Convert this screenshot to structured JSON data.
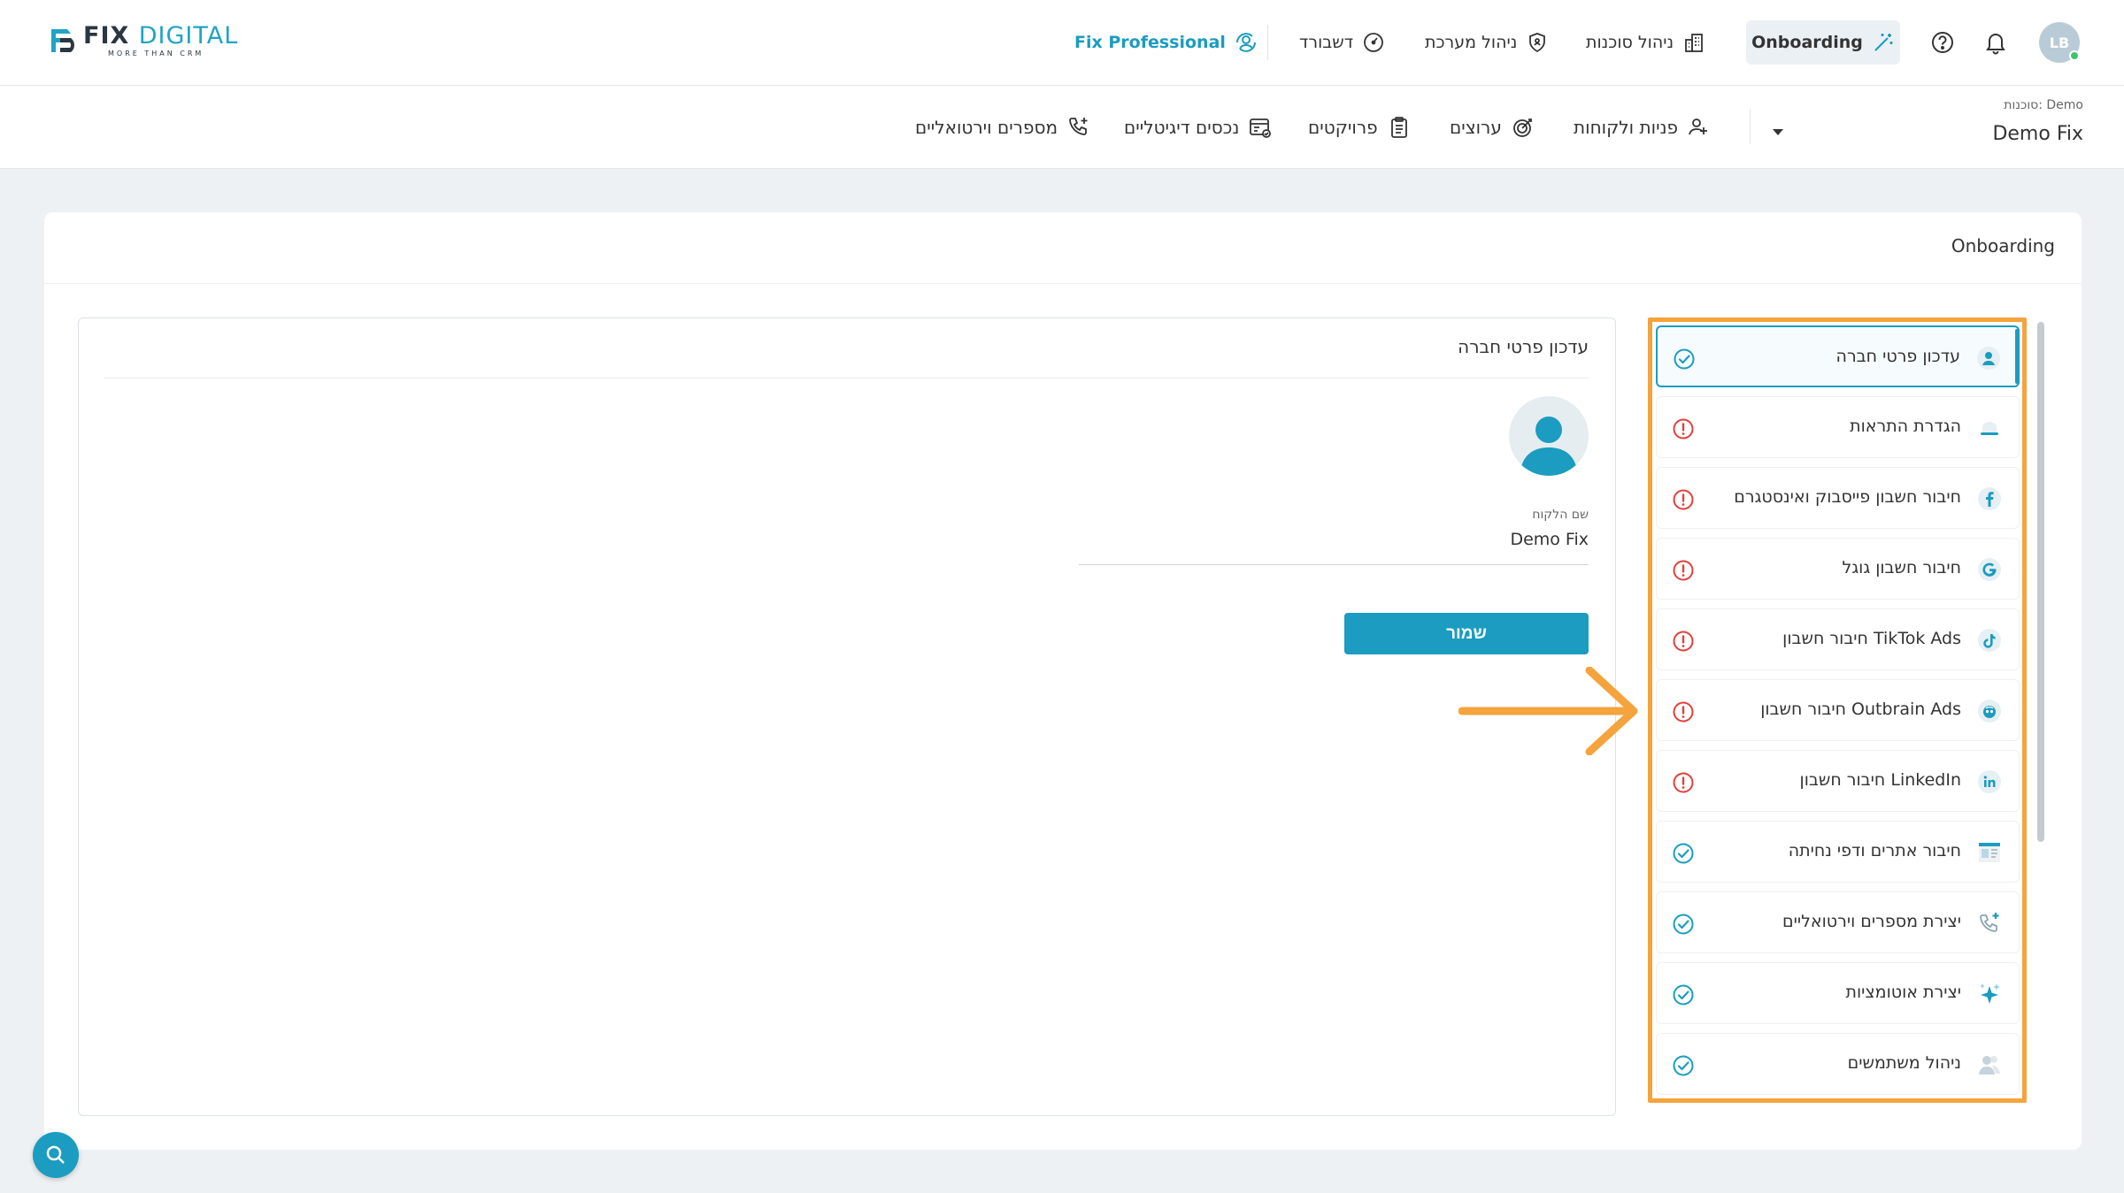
{
  "brand": {
    "logo_main_a": "FIX ",
    "logo_main_b": "DIGITAL",
    "logo_sub": "MORE THAN CRM",
    "accent": "#1b9cc0",
    "highlight": "#f5a33c"
  },
  "header": {
    "fix_professional": "Fix Professional",
    "dashboard": "דשבורד",
    "system_management": "ניהול מערכת",
    "agency_management": "ניהול סוכנות",
    "onboarding": "Onboarding",
    "avatar_initials": "LB"
  },
  "subnav": {
    "agency_label": "סוכנות: Demo",
    "agency_name": "Demo Fix",
    "items": [
      {
        "label": "פניות ולקוחות",
        "icon": "users-icon"
      },
      {
        "label": "ערוצים",
        "icon": "target-icon"
      },
      {
        "label": "פרויקטים",
        "icon": "clipboard-icon"
      },
      {
        "label": "נכסים דיגיטליים",
        "icon": "digital-assets-icon"
      },
      {
        "label": "מספרים וירטואליים",
        "icon": "phone-plus-icon"
      }
    ]
  },
  "page": {
    "title": "Onboarding"
  },
  "form": {
    "title": "עדכון פרטי חברה",
    "customer_name_label": "שם הלקוח",
    "customer_name_value": "Demo Fix",
    "save_label": "שמור"
  },
  "steps": [
    {
      "label": "עדכון פרטי חברה",
      "icon": "person-icon",
      "status": "done",
      "active": true
    },
    {
      "label": "הגדרת התראות",
      "icon": "bell-icon",
      "status": "warning",
      "active": false
    },
    {
      "label": "חיבור חשבון פייסבוק ואינסטגרם",
      "icon": "facebook-icon",
      "status": "warning",
      "active": false
    },
    {
      "label": "חיבור חשבון גוגל",
      "icon": "google-icon",
      "status": "warning",
      "active": false
    },
    {
      "label": "חיבור חשבון TikTok Ads",
      "icon": "tiktok-icon",
      "status": "warning",
      "active": false
    },
    {
      "label": "חיבור חשבון Outbrain Ads",
      "icon": "outbrain-icon",
      "status": "warning",
      "active": false
    },
    {
      "label": "חיבור חשבון LinkedIn",
      "icon": "linkedin-icon",
      "status": "warning",
      "active": false
    },
    {
      "label": "חיבור אתרים ודפי נחיתה",
      "icon": "landing-page-icon",
      "status": "done",
      "active": false
    },
    {
      "label": "יצירת מספרים וירטואליים",
      "icon": "phone-plus-icon",
      "status": "done",
      "active": false
    },
    {
      "label": "יצירת אוטומציות",
      "icon": "sparkle-icon",
      "status": "done",
      "active": false
    },
    {
      "label": "ניהול משתמשים",
      "icon": "users-icon",
      "status": "done",
      "active": false
    }
  ]
}
